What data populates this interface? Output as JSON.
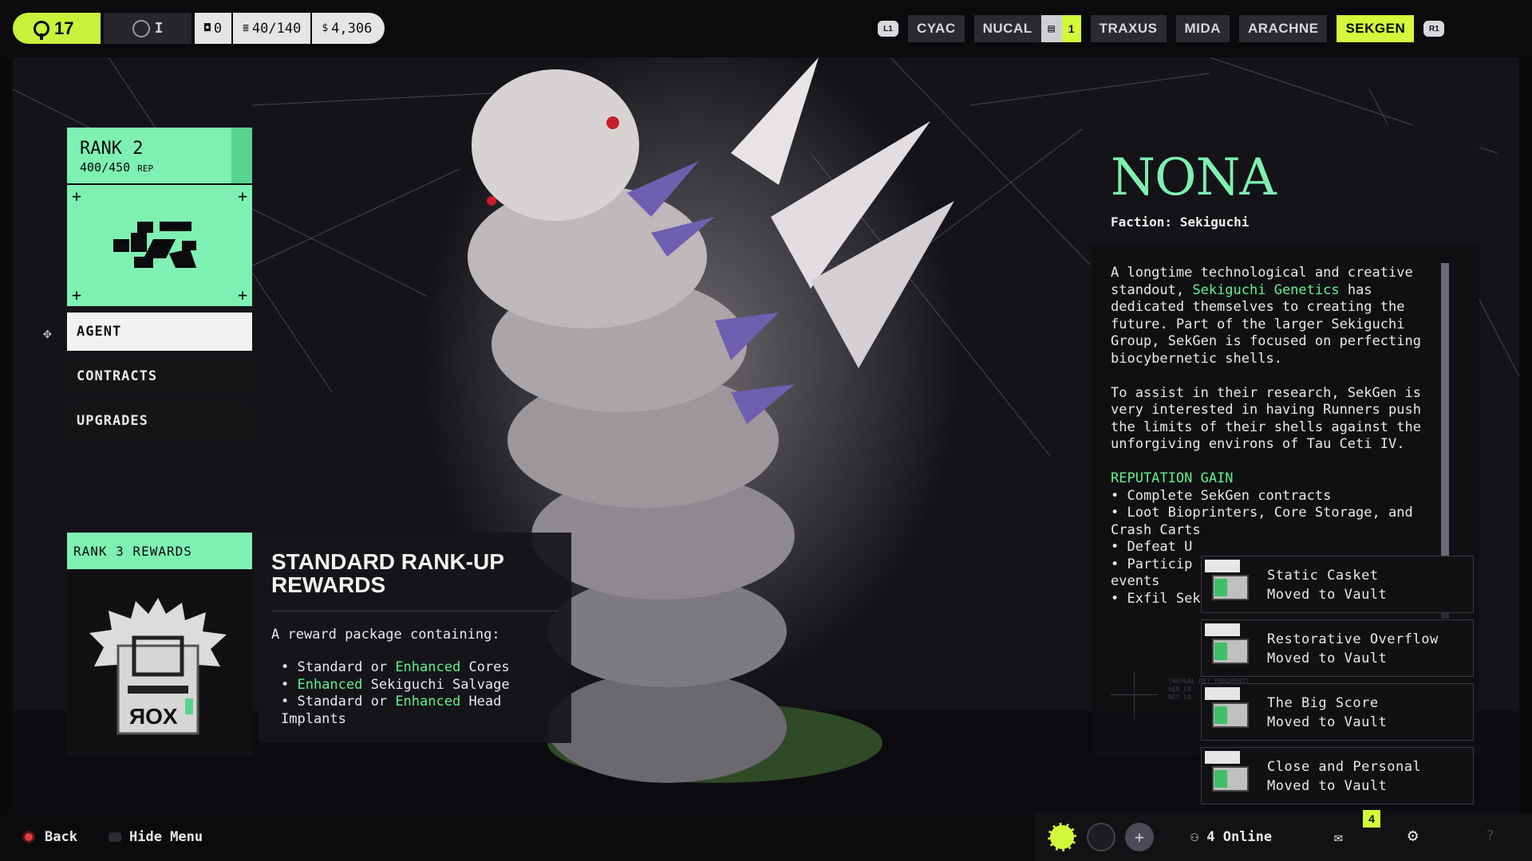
{
  "topbar": {
    "level": "17",
    "tier_label": "I",
    "counters": [
      {
        "icon": "crate-icon",
        "glyph": "◘",
        "value": "0"
      },
      {
        "icon": "stack-icon",
        "glyph": "≣",
        "value": "40/140"
      },
      {
        "icon": "credits-icon",
        "glyph": "$",
        "value": "4,306"
      }
    ],
    "left_bumper": "L1",
    "right_bumper": "R1",
    "factions": [
      "CYAC",
      "NUCAL",
      "TRAXUS",
      "MIDA",
      "ARACHNE",
      "SEKGEN"
    ],
    "active_faction": "SEKGEN",
    "nucal_badge": "1"
  },
  "left": {
    "rank_title": "RANK 2",
    "rank_rep": "400/450",
    "rank_rep_unit": "REP",
    "menu": [
      "AGENT",
      "CONTRACTS",
      "UPGRADES"
    ],
    "active_menu": "AGENT",
    "rewards_header": "RANK 3 REWARDS"
  },
  "standard": {
    "title": "STANDARD RANK-UP REWARDS",
    "intro": "A reward package containing:",
    "items": [
      {
        "a": "Standard or ",
        "hl": "Enhanced",
        "b": " Cores"
      },
      {
        "a": "",
        "hl": "Enhanced",
        "b": " Sekiguchi Salvage"
      },
      {
        "a": "Standard or ",
        "hl": "Enhanced",
        "b": " Head Implants"
      }
    ]
  },
  "info": {
    "name": "NONA",
    "faction": "Faction: Sekiguchi",
    "p1_a": "A longtime technological and creative standout, ",
    "p1_hl": "Sekiguchi Genetics",
    "p1_b": " has dedicated themselves to creating the future. Part of the larger Sekiguchi Group, SekGen is focused on perfecting biocybernetic shells.",
    "p2": "To assist in their research, SekGen is very interested in having Runners push the limits of their shells against the unforgiving environs of Tau Ceti IV.",
    "rep_heading": "REPUTATION GAIN",
    "rep_items": [
      "Complete SekGen contracts",
      "Loot Bioprinters, Core Storage, and Crash Carts",
      "Defeat U",
      "Particip",
      "events",
      "Exfil SekGen Valuables"
    ],
    "faint_text": "[NEURAL NET FRAGMENT]\nSEN CO\nNET CO"
  },
  "notifications": [
    {
      "title": "Static Casket",
      "status": "Moved to Vault"
    },
    {
      "title": "Restorative Overflow",
      "status": "Moved to Vault"
    },
    {
      "title": "The Big Score",
      "status": "Moved to Vault"
    },
    {
      "title": "Close and Personal",
      "status": "Moved to Vault"
    }
  ],
  "bottom": {
    "back": "Back",
    "hide_menu": "Hide Menu",
    "online": "4 Online",
    "mail_count": "4",
    "help": "?"
  },
  "colors": {
    "accent_lime": "#d4f83a",
    "accent_mint": "#7ef0b2",
    "highlight_green": "#5ff28f"
  }
}
